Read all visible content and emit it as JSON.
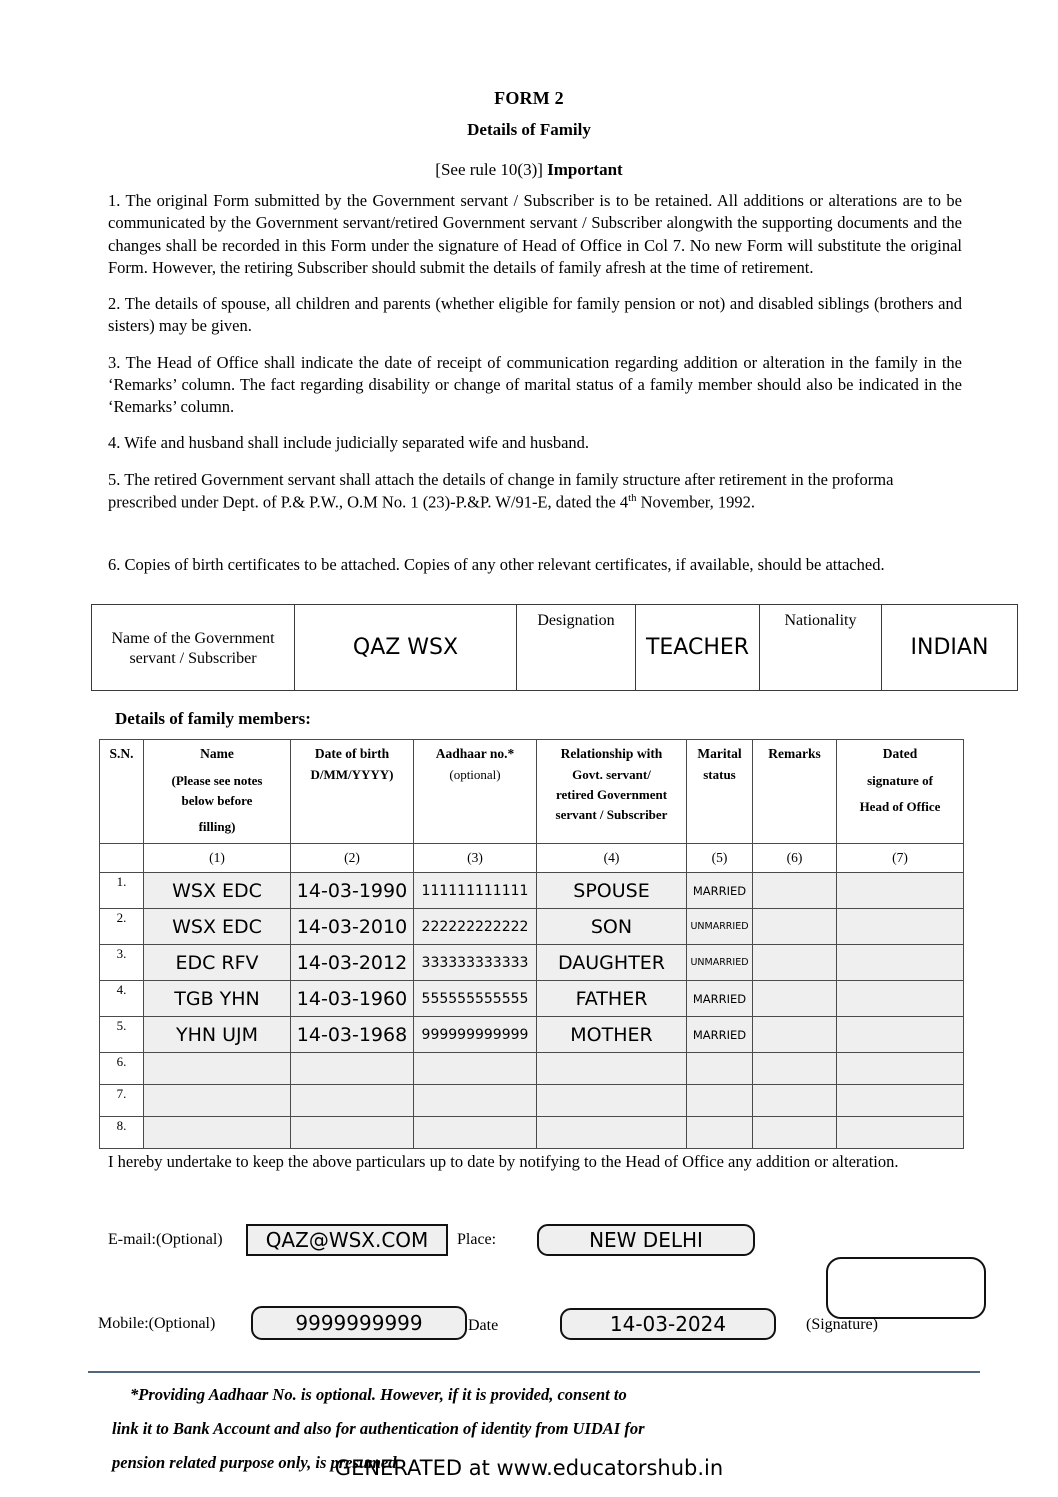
{
  "header": {
    "form_title": "FORM 2",
    "sub_title": "Details of Family",
    "rule_ref": "[See rule 10(3)] ",
    "rule_important": "Important"
  },
  "notes": [
    "1. The original Form submitted by the Government servant / Subscriber is to be retained. All additions or alterations are to be communicated by the Government servant/retired Government servant / Subscriber alongwith the supporting documents and the changes shall be recorded in this Form under the signature of Head of Office in Col 7. No new Form will substitute the original Form. However, the retiring Subscriber should submit the details of family afresh at the time of retirement.",
    "2. The details of spouse, all children and parents (whether eligible for family pension or not) and disabled siblings (brothers and sisters) may be given.",
    "3. The Head of Office shall indicate the date of receipt of communication regarding addition or alteration in the family in the ‘Remarks’ column. The fact regarding disability or change of marital status of a family member should also be indicated in the ‘Remarks’ column.",
    "4.  Wife and husband shall include judicially separated wife and husband."
  ],
  "note5": {
    "part1": "5.  The retired Government servant shall attach the details of change in family structure after retirement in the proforma prescribed under Dept. of P.& P.W., O.M No. 1 (23)-P.&P. W/91-E, dated the 4",
    "sup": "th",
    "part2": " November, 1992."
  },
  "note6": "6. Copies of birth certificates to be attached. Copies of any other relevant certificates, if available, should be attached.",
  "info_table": {
    "name_label": "Name of the Government servant / Subscriber",
    "name_value": "QAZ WSX",
    "designation_label": "Designation",
    "designation_value": "TEACHER",
    "nationality_label": "Nationality",
    "nationality_value": "INDIAN"
  },
  "family": {
    "heading": "Details of family members:",
    "columns": {
      "sn": "S.N.",
      "name": "Name",
      "name_sub1": "(Please see notes",
      "name_sub2": "below before",
      "name_sub3": "filling)",
      "dob": "Date of birth",
      "dob_sub": "D/MM/YYYY)",
      "aadhaar": "Aadhaar no.*",
      "aadhaar_sub": "(optional)",
      "relationship1": "Relationship with",
      "relationship2": "Govt. servant/",
      "relationship3": "retired Government",
      "relationship4": "servant / Subscriber",
      "marital1": "Marital",
      "marital2": "status",
      "remarks": "Remarks",
      "dated1": "Dated",
      "dated2": "signature of",
      "dated3": "Head of Office"
    },
    "col_numbers": [
      "",
      "(1)",
      "(2)",
      "(3)",
      "(4)",
      "(5)",
      "(6)",
      "(7)"
    ],
    "rows": [
      {
        "sn": "1.",
        "name": "WSX EDC",
        "dob": "14-03-1990",
        "aadhaar": "111111111111",
        "relationship": "SPOUSE",
        "marital": "MARRIED",
        "marital_size": "lg",
        "remarks": "",
        "signature": ""
      },
      {
        "sn": "2.",
        "name": "WSX EDC",
        "dob": "14-03-2010",
        "aadhaar": "222222222222",
        "relationship": "SON",
        "marital": "UNMARRIED",
        "marital_size": "sm",
        "remarks": "",
        "signature": ""
      },
      {
        "sn": "3.",
        "name": "EDC RFV",
        "dob": "14-03-2012",
        "aadhaar": "333333333333",
        "relationship": "DAUGHTER",
        "marital": "UNMARRIED",
        "marital_size": "sm",
        "remarks": "",
        "signature": ""
      },
      {
        "sn": "4.",
        "name": "TGB YHN",
        "dob": "14-03-1960",
        "aadhaar": "555555555555",
        "relationship": "FATHER",
        "marital": "MARRIED",
        "marital_size": "lg",
        "remarks": "",
        "signature": ""
      },
      {
        "sn": "5.",
        "name": "YHN UJM",
        "dob": "14-03-1968",
        "aadhaar": "999999999999",
        "relationship": "MOTHER",
        "marital": "MARRIED",
        "marital_size": "lg",
        "remarks": "",
        "signature": ""
      },
      {
        "sn": "6.",
        "name": "",
        "dob": "",
        "aadhaar": "",
        "relationship": "",
        "marital": "",
        "marital_size": "lg",
        "remarks": "",
        "signature": ""
      },
      {
        "sn": "7.",
        "name": "",
        "dob": "",
        "aadhaar": "",
        "relationship": "",
        "marital": "",
        "marital_size": "lg",
        "remarks": "",
        "signature": ""
      },
      {
        "sn": "8.",
        "name": "",
        "dob": "",
        "aadhaar": "",
        "relationship": "",
        "marital": "",
        "marital_size": "lg",
        "remarks": "",
        "signature": ""
      }
    ]
  },
  "undertaking": "I hereby undertake to keep the above particulars up to date by notifying to the Head of Office any addition or alteration.",
  "fields": {
    "email_label": "E-mail:(Optional)",
    "email_value": "QAZ@WSX.COM",
    "place_label": "Place:",
    "place_value": "NEW DELHI",
    "mobile_label": "Mobile:(Optional)",
    "mobile_value": "9999999999",
    "date_label": "Date",
    "date_value": "14-03-2024",
    "signature_label": "(Signature)",
    "signature_value": ""
  },
  "footer": {
    "line1": "*Providing Aadhaar No. is optional. However, if it is provided, consent to",
    "line2": "link it to Bank Account and also for authentication of identity from UIDAI for",
    "line3": "pension related purpose only, is presumed",
    "generated": "GENERATED at www.educatorshub.in",
    "rule_color": "#51687c"
  }
}
